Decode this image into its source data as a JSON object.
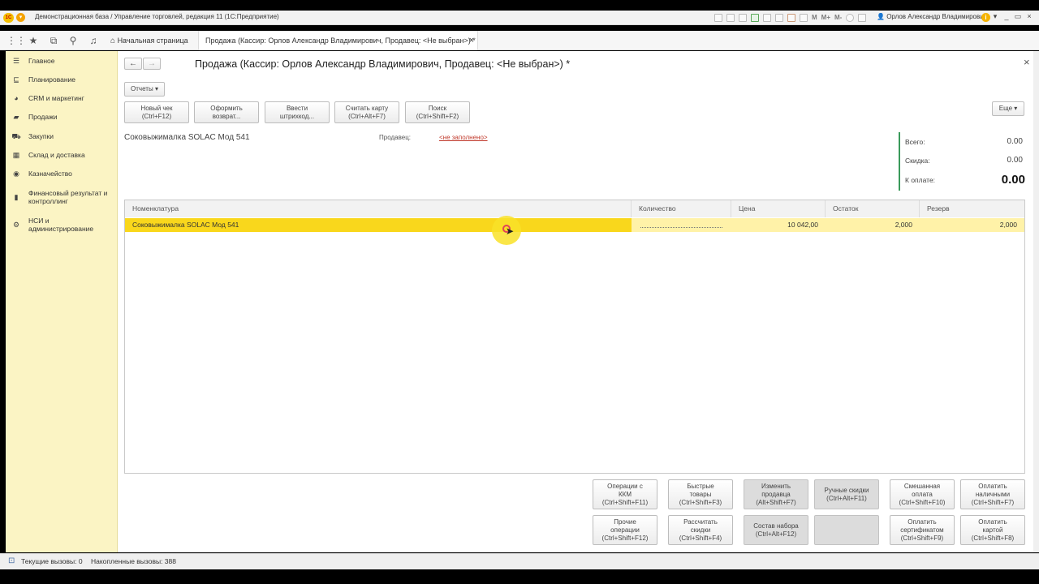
{
  "window": {
    "title": "Демонстрационная база / Управление торговлей, редакция 11  (1С:Предприятие)",
    "logo_text": "1С",
    "user": "Орлов Александр Владимирович",
    "controls": [
      "_",
      "▭",
      "×"
    ]
  },
  "nav": {
    "tabs": [
      {
        "label": "Начальная страница"
      },
      {
        "label": "Продажа (Кассир: Орлов Александр Владимирович, Продавец: <Не выбран>) *"
      }
    ],
    "tab_close": "×"
  },
  "sidebar": {
    "items": [
      {
        "label": "Главное",
        "icon": "menu-lines-icon"
      },
      {
        "label": "Планирование",
        "icon": "planning-icon"
      },
      {
        "label": "CRM и маркетинг",
        "icon": "crm-pie-icon"
      },
      {
        "label": "Продажи",
        "icon": "sales-icon"
      },
      {
        "label": "Закупки",
        "icon": "cart-icon"
      },
      {
        "label": "Склад и доставка",
        "icon": "warehouse-icon"
      },
      {
        "label": "Казначейство",
        "icon": "treasury-icon"
      },
      {
        "label": "Финансовый результат и контроллинг",
        "icon": "bar-chart-icon"
      },
      {
        "label": "НСИ и администрирование",
        "icon": "gear-icon"
      }
    ]
  },
  "form": {
    "title": "Продажа (Кассир: Орлов Александр Владимирович, Продавец: <Не выбран>) *",
    "close": "×",
    "reports_label": "Отчеты",
    "more_label": "Еще",
    "toolbar": [
      {
        "line1": "Новый чек",
        "line2": "(Ctrl+F12)"
      },
      {
        "line1": "Оформить",
        "line2": "возврат..."
      },
      {
        "line1": "Ввести",
        "line2": "штрихкод..."
      },
      {
        "line1": "Считать карту",
        "line2": "(Ctrl+Alt+F7)"
      },
      {
        "line1": "Поиск",
        "line2": "(Ctrl+Shift+F2)"
      }
    ],
    "current_item": "Соковыжималка  SOLAC  Мод 541",
    "seller_label": "Продавец:",
    "seller_value": "<не заполнено>",
    "totals": {
      "total_label": "Всего:",
      "total_value": "0.00",
      "discount_label": "Скидка:",
      "discount_value": "0.00",
      "pay_label": "К оплате:",
      "pay_value": "0.00"
    }
  },
  "grid": {
    "columns": [
      "Номенклатура",
      "Количество",
      "Цена",
      "Остаток",
      "Резерв"
    ],
    "rows": [
      {
        "name": "Соковыжималка  SOLAC  Мод 541",
        "qty": "",
        "price": "10 042,00",
        "stock": "2,000",
        "reserve": "2,000"
      }
    ]
  },
  "actions": {
    "row1": [
      {
        "l1": "Операции с",
        "l2": "ККМ",
        "l3": "(Ctrl+Shift+F11)"
      },
      {
        "l1": "Быстрые",
        "l2": "товары",
        "l3": "(Ctrl+Shift+F3)"
      },
      {
        "l1": "Изменить",
        "l2": "продавца",
        "l3": "(Alt+Shift+F7)"
      },
      {
        "l1": "Ручные скидки",
        "l2": "(Ctrl+Alt+F11)",
        "l3": ""
      },
      {
        "l1": "Смешанная",
        "l2": "оплата",
        "l3": "(Ctrl+Shift+F10)"
      },
      {
        "l1": "Оплатить",
        "l2": "наличными",
        "l3": "(Ctrl+Shift+F7)"
      }
    ],
    "row2": [
      {
        "l1": "Прочие",
        "l2": "операции",
        "l3": "(Ctrl+Shift+F12)"
      },
      {
        "l1": "Рассчитать",
        "l2": "скидки",
        "l3": "(Ctrl+Shift+F4)"
      },
      {
        "l1": "Состав набора",
        "l2": "(Ctrl+Alt+F12)",
        "l3": ""
      },
      {
        "l1": "",
        "l2": "",
        "l3": ""
      },
      {
        "l1": "Оплатить",
        "l2": "сертификатом",
        "l3": "(Ctrl+Shift+F9)"
      },
      {
        "l1": "Оплатить",
        "l2": "картой",
        "l3": "(Ctrl+Shift+F8)"
      }
    ]
  },
  "status": {
    "current_calls": "Текущие вызовы: 0",
    "accumulated_calls": "Накопленные вызовы: 388"
  },
  "colors": {
    "sidebar_bg": "#fbf4c4",
    "selected_row": "#f9d71c",
    "accent_green": "#3a9a5a",
    "link_red": "#c0392b"
  }
}
